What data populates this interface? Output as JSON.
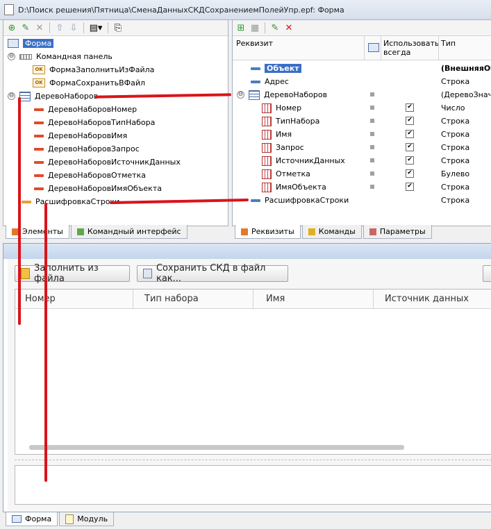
{
  "window": {
    "title": "D:\\Поиск решения\\Пятница\\СменаДанныхСКДСохранениемПолейУпр.epf: Форма"
  },
  "left_panel": {
    "tree": [
      {
        "label": "Форма",
        "level": 0,
        "icon": "form-icon",
        "selected": true
      },
      {
        "label": "Командная панель",
        "level": 1,
        "icon": "command-panel-icon",
        "expander": "⊖"
      },
      {
        "label": "ФормаЗаполнитьИзФайла",
        "level": 2,
        "icon": "ok-command-icon"
      },
      {
        "label": "ФормаСохранитьВФайл",
        "level": 2,
        "icon": "ok-command-icon"
      },
      {
        "label": "ДеревоНаборов",
        "level": 1,
        "icon": "table-icon",
        "expander": "⊖"
      },
      {
        "label": "ДеревоНаборовНомер",
        "level": 2,
        "icon": "field-icon"
      },
      {
        "label": "ДеревоНаборовТипНабора",
        "level": 2,
        "icon": "field-icon"
      },
      {
        "label": "ДеревоНаборовИмя",
        "level": 2,
        "icon": "field-icon"
      },
      {
        "label": "ДеревоНаборовЗапрос",
        "level": 2,
        "icon": "field-icon"
      },
      {
        "label": "ДеревоНаборовИсточникДанных",
        "level": 2,
        "icon": "field-icon"
      },
      {
        "label": "ДеревоНаборовОтметка",
        "level": 2,
        "icon": "field-icon"
      },
      {
        "label": "ДеревоНаборовИмяОбъекта",
        "level": 2,
        "icon": "field-icon"
      },
      {
        "label": "РасшифровкаСтроки",
        "level": 1,
        "icon": "field-orange-icon"
      }
    ],
    "tabs": [
      {
        "label": "Элементы",
        "active": true
      },
      {
        "label": "Командный интерфейс",
        "active": false
      }
    ]
  },
  "right_panel": {
    "headers": {
      "requisite": "Реквизит",
      "always_use": "Использовать всегда",
      "type": "Тип"
    },
    "rows": [
      {
        "label": "Объект",
        "type": "(ВнешняяОбр",
        "bold": true,
        "level": 0,
        "icon": "field-blue-icon",
        "marker": false,
        "checked": null
      },
      {
        "label": "Адрес",
        "type": "Строка",
        "level": 0,
        "icon": "field-blue-icon",
        "marker": false,
        "checked": null
      },
      {
        "label": "ДеревоНаборов",
        "type": "(ДеревоЗначен",
        "level": 0,
        "icon": "table-icon",
        "expander": "⊖",
        "marker": true,
        "checked": null
      },
      {
        "label": "Номер",
        "type": "Число",
        "level": 1,
        "icon": "column-icon",
        "marker": true,
        "checked": "✔"
      },
      {
        "label": "ТипНабора",
        "type": "Строка",
        "level": 1,
        "icon": "column-icon",
        "marker": true,
        "checked": "✔"
      },
      {
        "label": "Имя",
        "type": "Строка",
        "level": 1,
        "icon": "column-icon",
        "marker": true,
        "checked": "✔"
      },
      {
        "label": "Запрос",
        "type": "Строка",
        "level": 1,
        "icon": "column-icon",
        "marker": true,
        "checked": "✔"
      },
      {
        "label": "ИсточникДанных",
        "type": "Строка",
        "level": 1,
        "icon": "column-icon",
        "marker": true,
        "checked": "✔"
      },
      {
        "label": "Отметка",
        "type": "Булево",
        "level": 1,
        "icon": "column-icon",
        "marker": true,
        "checked": "✔"
      },
      {
        "label": "ИмяОбъекта",
        "type": "Строка",
        "level": 1,
        "icon": "column-icon",
        "marker": true,
        "checked": "✔"
      },
      {
        "label": "РасшифровкаСтроки",
        "type": "Строка",
        "level": 0,
        "icon": "field-blue-icon",
        "marker": false,
        "checked": null
      }
    ],
    "tabs": [
      {
        "label": "Реквизиты",
        "active": true
      },
      {
        "label": "Команды",
        "active": false
      },
      {
        "label": "Параметры",
        "active": false
      }
    ]
  },
  "preview": {
    "buttons": {
      "fill_from_file": "Заполнить из файла",
      "save_skd": "Сохранить СКД в файл как..."
    },
    "columns": [
      "Номер",
      "Тип набора",
      "Имя",
      "Источник данных"
    ]
  },
  "bottom_tabs": [
    {
      "label": "Форма",
      "active": true
    },
    {
      "label": "Модуль",
      "active": false
    }
  ],
  "colors": {
    "accent_red": "#d9141b",
    "selection": "#3b6fc5"
  }
}
